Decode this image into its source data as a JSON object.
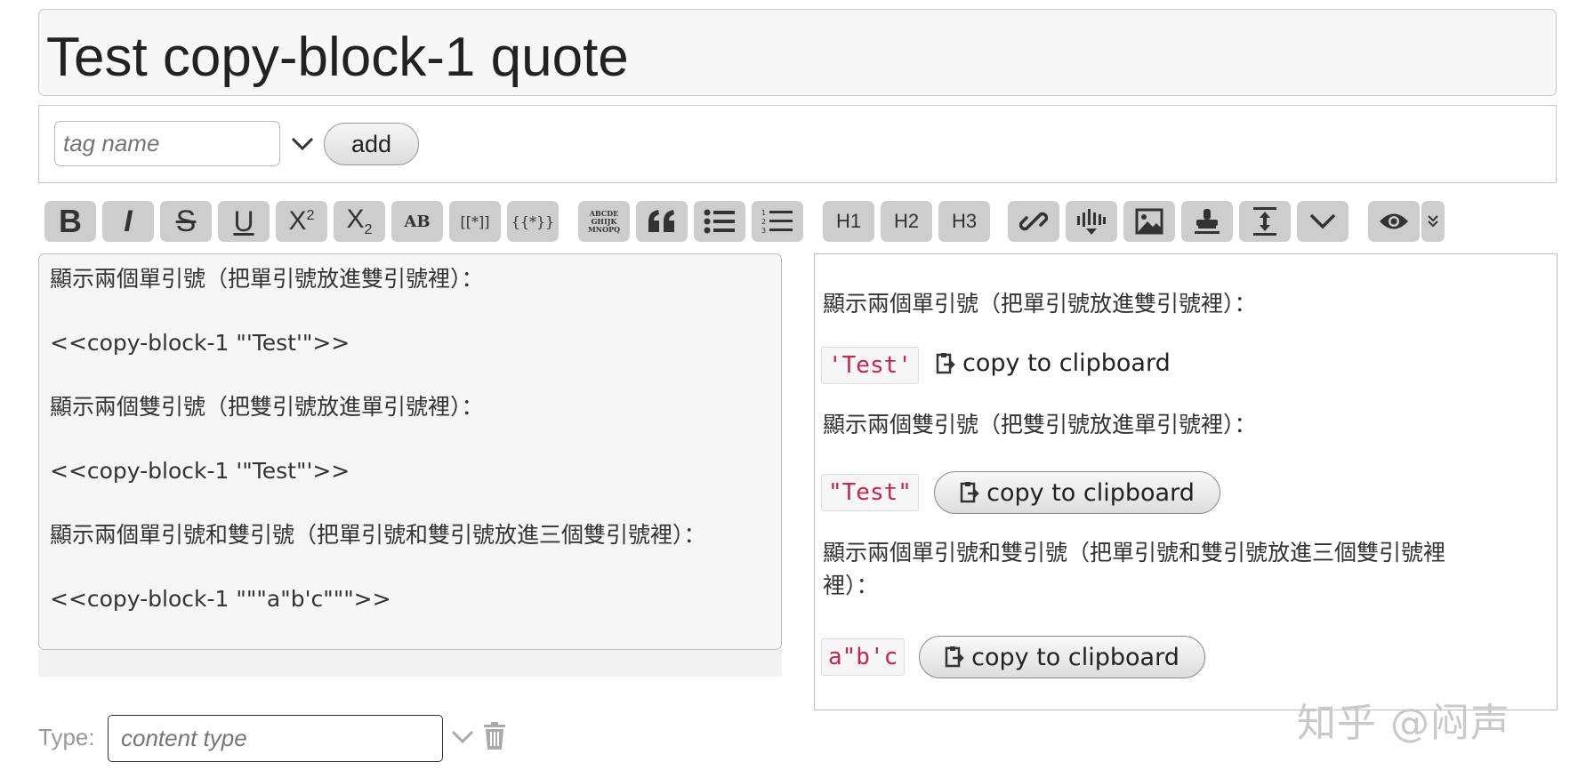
{
  "title": "Test copy-block-1 quote",
  "tags": {
    "placeholder": "tag name",
    "add_label": "add",
    "dropdown_icon": "chevron-down-icon"
  },
  "toolbar": {
    "bold": "B",
    "italic": "I",
    "strike": "S",
    "underline": "U",
    "superscript": "X",
    "superscript_mark": "2",
    "subscript": "X",
    "subscript_mark": "2",
    "smallcaps": "AB",
    "transclude": "[[*]]",
    "macro": "{{*}}",
    "monospace_lines": [
      "ABCDE",
      "GHIJK",
      "MNOPQ"
    ],
    "h1": "H1",
    "h2": "H2",
    "h3": "H3",
    "icons": [
      "bold-icon",
      "italic-icon",
      "strikethrough-icon",
      "underline-icon",
      "superscript-icon",
      "subscript-icon",
      "smallcaps-icon",
      "transclude-icon",
      "macro-icon",
      "monospace-block-icon",
      "quote-icon",
      "bullet-list-icon",
      "numbered-list-icon",
      "link-icon",
      "excise-icon",
      "image-icon",
      "stamp-icon",
      "size-icon",
      "more-icon",
      "preview-eye-icon",
      "preview-type-chevron-icon"
    ]
  },
  "editor": {
    "text": "顯示兩個單引號（把單引號放進雙引號裡）：\n\n<<copy-block-1 \"'Test'\">>\n\n顯示兩個雙引號（把雙引號放進單引號裡）：\n\n<<copy-block-1 '\"Test\"'>>\n\n顯示兩個單引號和雙引號（把單引號和雙引號放進三個雙引號裡）：\n\n<<copy-block-1 \"\"\"a\"b'c\"\"\">>"
  },
  "preview": {
    "line1": "顯示兩個單引號（把單引號放進雙引號裡）：",
    "code1": "'Test'",
    "copy1": "copy to clipboard",
    "line2": "顯示兩個雙引號（把雙引號放進單引號裡）：",
    "code2": "\"Test\"",
    "copy2": "copy to clipboard",
    "line3a": "顯示兩個單引號和雙引號（把單引號和雙引號放進三個雙引號裡",
    "line3b": "裡）：",
    "code3": "a\"b'c",
    "copy3": "copy to clipboard",
    "copy_icon": "clipboard-icon"
  },
  "type_field": {
    "label": "Type:",
    "placeholder": "content type",
    "dropdown_icon": "chevron-down-icon",
    "delete_icon": "trash-icon"
  },
  "watermark": "知乎 @闷声"
}
